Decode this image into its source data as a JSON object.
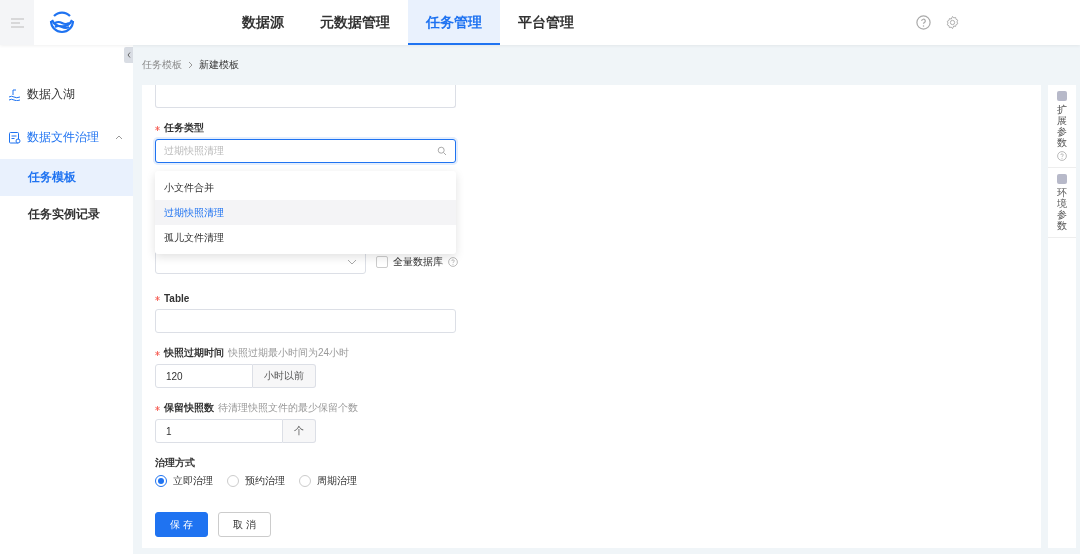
{
  "header": {
    "nav": [
      {
        "label": "数据源",
        "selected": false
      },
      {
        "label": "元数据管理",
        "selected": false
      },
      {
        "label": "任务管理",
        "selected": true
      },
      {
        "label": "平台管理",
        "selected": false
      }
    ]
  },
  "sidebar": {
    "items": [
      {
        "label": "数据入湖",
        "kind": "link"
      },
      {
        "label": "数据文件治理",
        "kind": "group",
        "expanded": true,
        "children": [
          {
            "label": "任务模板",
            "selected": true
          },
          {
            "label": "任务实例记录",
            "selected": false
          }
        ]
      }
    ]
  },
  "breadcrumb": [
    "任务模板",
    "新建模板"
  ],
  "form": {
    "fields": [
      {
        "kind": "search_select",
        "label": "任务类型",
        "required": true,
        "placeholder": "过期快照清理",
        "open": true,
        "options": [
          {
            "label": "小文件合并",
            "selected": false
          },
          {
            "label": "过期快照清理",
            "selected": true
          },
          {
            "label": "孤儿文件清理",
            "selected": false
          }
        ]
      },
      {
        "kind": "select_checkbox",
        "checkbox": {
          "label": "全量数据库",
          "checked": false
        }
      },
      {
        "kind": "input",
        "label": "Table",
        "required": true
      },
      {
        "kind": "addon",
        "label": "快照过期时间",
        "hint": "快照过期最小时间为24小时",
        "required": true,
        "value": "120",
        "addon": "小时以前"
      },
      {
        "kind": "addon",
        "label": "保留快照数",
        "hint": "待清理快照文件的最少保留个数",
        "required": true,
        "value": "1",
        "addon": "个"
      },
      {
        "kind": "radio",
        "label": "治理方式",
        "required": false,
        "options": [
          {
            "label": "立即治理",
            "selected": true
          },
          {
            "label": "预约治理",
            "selected": false
          },
          {
            "label": "周期治理",
            "selected": false
          }
        ]
      }
    ],
    "buttons": [
      {
        "label": "保 存",
        "kind": "primary"
      },
      {
        "label": "取 消",
        "kind": "default"
      }
    ]
  },
  "side_panel": [
    {
      "label": "扩展参数",
      "help": true
    },
    {
      "label": "环境参数",
      "help": false
    }
  ]
}
